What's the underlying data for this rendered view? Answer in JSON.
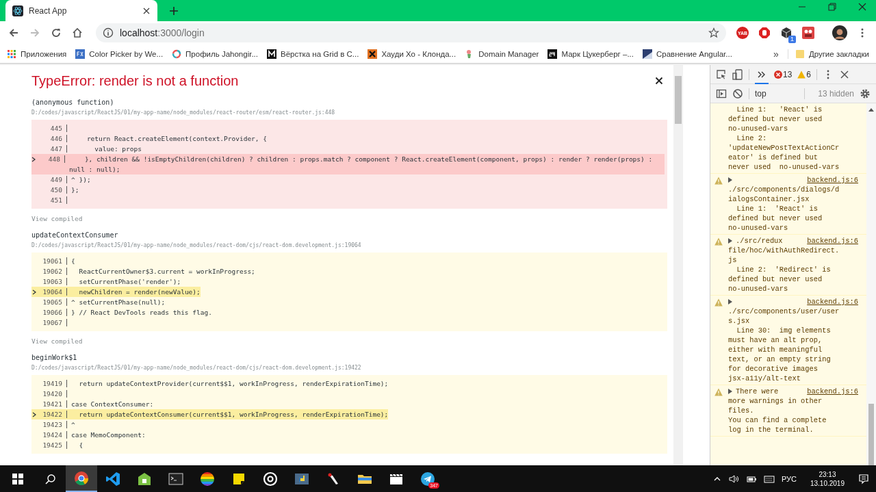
{
  "browser": {
    "tab": {
      "title": "React App",
      "selected": true
    },
    "address": {
      "host": "localhost",
      "path": ":3000/login"
    },
    "extension_badge": "1",
    "yab_label": "YAB",
    "bookmarks": [
      {
        "label": "Приложения"
      },
      {
        "label": "Color Picker by We..."
      },
      {
        "label": "Профиль Jahongir..."
      },
      {
        "label": "Вёрстка на Grid в С..."
      },
      {
        "label": "Хауди Хо - Клонда..."
      },
      {
        "label": "Domain Manager"
      },
      {
        "label": "Марк Цукерберг –..."
      },
      {
        "label": "Сравнение Angular..."
      }
    ],
    "bookmarks_more": "»",
    "other_bookmarks": "Другие закладки"
  },
  "error": {
    "title": "TypeError: render is not a function",
    "frames": [
      {
        "function": "(anonymous function)",
        "file": "D:/codes/javascript/ReactJS/01/my-app-name/node_modules/react-router/esm/react-router.js:448",
        "show_compiled": "View compiled",
        "lines": [
          {
            "num": "445",
            "current": false
          },
          {
            "num": "446",
            "current": false,
            "code": "    return React.createElement(context.Provider, {"
          },
          {
            "num": "447",
            "current": false,
            "code": "      value: props"
          },
          {
            "num": "448",
            "current": true,
            "code": "    }, children && !isEmptyChildren(children) ? children : props.match ? component ? React.createElement(component, props) : render ? render(props) : null : null);"
          },
          {
            "num": "449",
            "current": false,
            "code": "^ });"
          },
          {
            "num": "450",
            "current": false,
            "code": "};"
          },
          {
            "num": "451",
            "current": false
          }
        ]
      },
      {
        "function": "updateContextConsumer",
        "file": "D:/codes/javascript/ReactJS/01/my-app-name/node_modules/react-dom/cjs/react-dom.development.js:19064",
        "show_compiled": "View compiled",
        "lines": [
          {
            "num": "19061",
            "current": false,
            "code": "{"
          },
          {
            "num": "19062",
            "current": false,
            "code": "  ReactCurrentOwner$3.current = workInProgress;"
          },
          {
            "num": "19063",
            "current": false,
            "code": "  setCurrentPhase('render');"
          },
          {
            "num": "19064",
            "current": true,
            "code": "  newChildren = render(newValue);"
          },
          {
            "num": "19065",
            "current": false,
            "code": "^ setCurrentPhase(null);"
          },
          {
            "num": "19066",
            "current": false,
            "code": "} // React DevTools reads this flag."
          },
          {
            "num": "19067",
            "current": false
          }
        ]
      },
      {
        "function": "beginWork$1",
        "file": "D:/codes/javascript/ReactJS/01/my-app-name/node_modules/react-dom/cjs/react-dom.development.js:19422",
        "lines": [
          {
            "num": "19419",
            "current": false,
            "code": "  return updateContextProvider(current$$1, workInProgress, renderExpirationTime);"
          },
          {
            "num": "19420",
            "current": false
          },
          {
            "num": "19421",
            "current": false,
            "code": "case ContextConsumer:"
          },
          {
            "num": "19422",
            "current": true,
            "code": "  return updateContextConsumer(current$$1, workInProgress, renderExpirationTime);"
          },
          {
            "num": "19423",
            "current": false,
            "code": "^"
          },
          {
            "num": "19424",
            "current": false,
            "code": "case MemoComponent:"
          },
          {
            "num": "19425",
            "current": false,
            "code": "  {"
          }
        ]
      }
    ]
  },
  "devtools": {
    "errors": "13",
    "warnings": "6",
    "context": "top",
    "hidden": "13 hidden",
    "messages": [
      {
        "warning": false,
        "lines": [
          "  Line 1:   'React' is",
          "defined but never used",
          "no-unused-vars",
          "  Line 2:",
          "'updateNewPostTextActionCr",
          "eator' is defined but",
          "never used  no-unused-vars"
        ]
      },
      {
        "warning": true,
        "expandable": true,
        "link": "backend.js:6",
        "lines": [
          "./src/components/dialogs/d",
          "ialogsContainer.jsx",
          "  Line 1:  'React' is",
          "defined but never used",
          "no-unused-vars"
        ]
      },
      {
        "warning": true,
        "expandable": true,
        "head": "./src/redux",
        "link": "backend.js:6",
        "lines": [
          "file/hoc/withAuthRedirect.",
          "js",
          "  Line 2:  'Redirect' is",
          "defined but never used",
          "no-unused-vars"
        ]
      },
      {
        "warning": true,
        "expandable": true,
        "link": "backend.js:6",
        "lines": [
          "./src/components/user/user",
          "s.jsx",
          "  Line 30:  img elements",
          "must have an alt prop,",
          "either with meaningful",
          "text, or an empty string",
          "for decorative images",
          "jsx-a11y/alt-text"
        ]
      },
      {
        "warning": true,
        "expandable": true,
        "head": "There were",
        "link": "backend.js:6",
        "lines": [
          "more warnings in other",
          "files.",
          "You can find a complete",
          "log in the terminal."
        ]
      }
    ]
  },
  "taskbar": {
    "apps": [
      {
        "selected": true
      },
      {
        "selected": false
      },
      {
        "selected": false
      },
      {
        "selected": false
      },
      {
        "selected": false
      },
      {
        "selected": false
      },
      {
        "selected": false
      },
      {
        "selected": false
      },
      {
        "selected": false
      },
      {
        "selected": false
      },
      {
        "selected": false
      },
      {
        "selected": false,
        "badge": "347"
      }
    ],
    "language": "РУС",
    "time": "23:13",
    "date": "13.10.2019"
  }
}
